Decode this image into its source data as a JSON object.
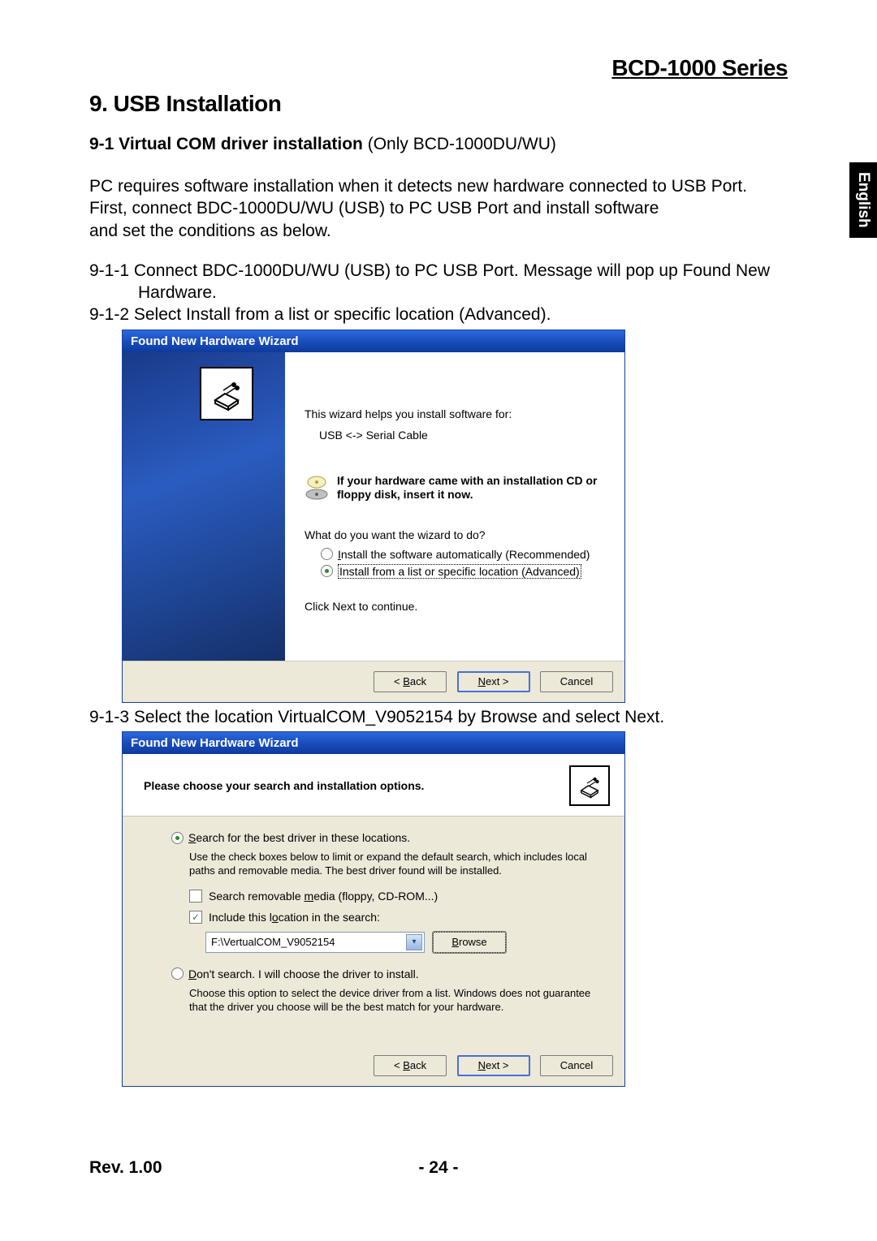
{
  "header": {
    "series": "BCD-1000 Series"
  },
  "h1": "9. USB Installation",
  "subsection_bold": "9-1 Virtual COM driver installation",
  "subsection_paren": " (Only BCD-1000DU/WU)",
  "para1": "PC requires software installation when it detects new hardware connected to USB Port. First, connect BDC-1000DU/WU (USB) to PC USB Port and install software\nand set the conditions as below.",
  "step1_lead": "9-1-1 Connect BDC-1000DU/WU (USB) to PC USB Port. Message will pop up Found New",
  "step1_cont": "Hardware.",
  "step2": "9-1-2 Select Install from a list or specific location (Advanced).",
  "step3": "9-1-3 Select the location VirtualCOM_V9052154 by Browse and select Next.",
  "lang_tab": "English",
  "footer": {
    "rev": "Rev. 1.00",
    "page": "- 24 -"
  },
  "dialog1": {
    "title": "Found New Hardware Wizard",
    "intro": "This wizard helps you install software for:",
    "device": "USB <-> Serial Cable",
    "cd_text": "If your hardware came with an installation CD or floppy disk, insert it now.",
    "question": "What do you want the wizard to do?",
    "opt_auto_pre": "I",
    "opt_auto": "nstall the software automatically (Recommended)",
    "opt_list": "Install from a list or specific location (Advanced)",
    "click_next": "Click Next to continue.",
    "btn_back_pre": "< ",
    "btn_back_u": "B",
    "btn_back_post": "ack",
    "btn_next_u": "N",
    "btn_next_post": "ext >",
    "btn_cancel": "Cancel"
  },
  "dialog2": {
    "title": "Found New Hardware Wizard",
    "header": "Please choose your search and installation options.",
    "opt_search_u": "S",
    "opt_search": "earch for the best driver in these locations.",
    "help1": "Use the check boxes below to limit or expand the default search, which includes local paths and removable media. The best driver found will be installed.",
    "chk_media_pre": "Search removable ",
    "chk_media_u": "m",
    "chk_media_post": "edia (floppy, CD-ROM...)",
    "chk_loc_pre": "Include this l",
    "chk_loc_u": "o",
    "chk_loc_post": "cation in the search:",
    "path_value": "F:\\VertualCOM_V9052154",
    "browse_u": "B",
    "browse_post": "rowse",
    "opt_dont_u": "D",
    "opt_dont": "on't search. I will choose the driver to install.",
    "help2": "Choose this option to select the device driver from a list.  Windows does not guarantee that the driver you choose will be the best match for your hardware.",
    "btn_back_pre": "< ",
    "btn_back_u": "B",
    "btn_back_post": "ack",
    "btn_next_u": "N",
    "btn_next_post": "ext >",
    "btn_cancel": "Cancel"
  }
}
